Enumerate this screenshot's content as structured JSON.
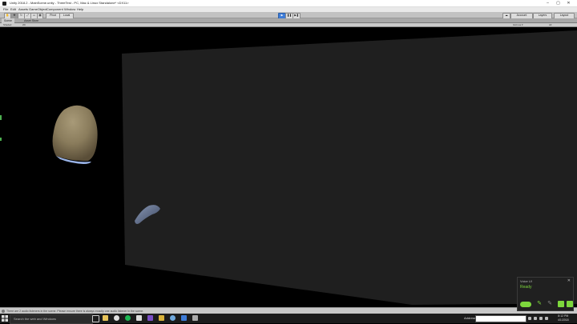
{
  "window": {
    "title": "Unity 2018.2 - MainScene.unity - ThreeTest - PC, Mac & Linux Standalone* <DX11>",
    "controls": [
      "–",
      "▢",
      "✕"
    ]
  },
  "menu": [
    "File",
    "Edit",
    "Assets",
    "GameObject",
    "Component",
    "Window",
    "Help"
  ],
  "toolbar": {
    "pivot_label": "Pivot",
    "local_label": "Local",
    "collab_label": "Collab ▾",
    "account_label": "Account",
    "layers_label": "Layers",
    "layout_label": "Layout"
  },
  "tabs": [
    "Scene",
    "Asset Store"
  ],
  "scene_bar": {
    "shading": "Shaded",
    "mode": "2D",
    "gizmos": "Gizmos ▾",
    "search": "All"
  },
  "status_bar": {
    "message": "There are 2 audio listeners in the scene. Please ensure there is always exactly one audio listener in the scene."
  },
  "taskbar": {
    "search_placeholder": "Search the web and Windows",
    "address_label": "Address",
    "time": "8:12 PM",
    "date": "4/1/2018"
  },
  "toast": {
    "header": "Voice UI",
    "status": "Ready"
  },
  "colors": {
    "accent_green": "#7dd73c",
    "play_blue": "#3d7bd6",
    "backdrop": "#1f1f1f"
  }
}
